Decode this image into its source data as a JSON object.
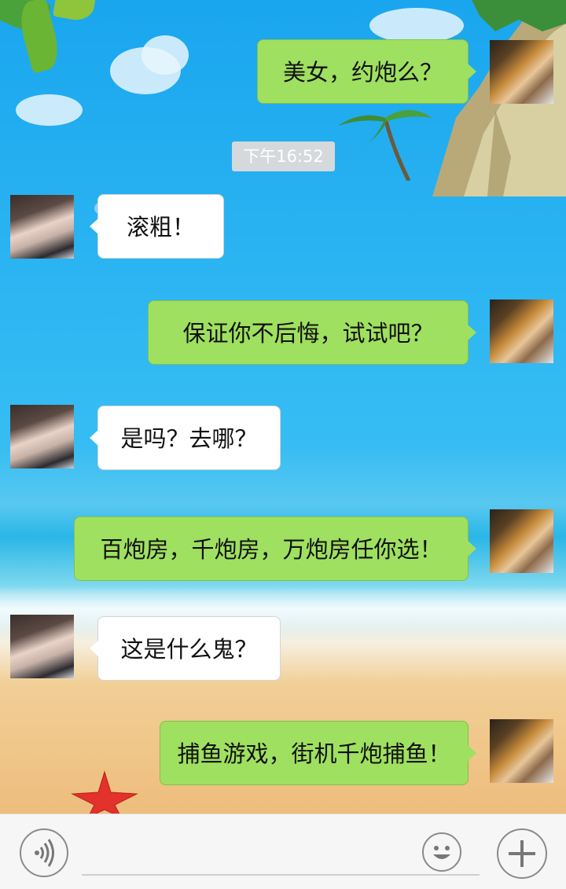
{
  "chat": {
    "timestamp": "下午16:52",
    "messages": [
      {
        "side": "out",
        "text": "美女，约炮么？"
      },
      {
        "side": "in",
        "text": "滚粗！"
      },
      {
        "side": "out",
        "text": "保证你不后悔，试试吧？"
      },
      {
        "side": "in",
        "text": "是吗？去哪？"
      },
      {
        "side": "out",
        "text": "百炮房，千炮房，万炮房任你选！"
      },
      {
        "side": "in",
        "text": "这是什么鬼？"
      },
      {
        "side": "out",
        "text": "捕鱼游戏，街机千炮捕鱼！"
      }
    ]
  },
  "input_bar": {
    "voice_icon": "voice-wave-icon",
    "emoji_icon": "smiley-icon",
    "add_icon": "plus-icon",
    "text_value": ""
  },
  "colors": {
    "outgoing_bubble": "#9fe060",
    "incoming_bubble": "#ffffff",
    "timestamp_bg": "#d6d9dc"
  }
}
